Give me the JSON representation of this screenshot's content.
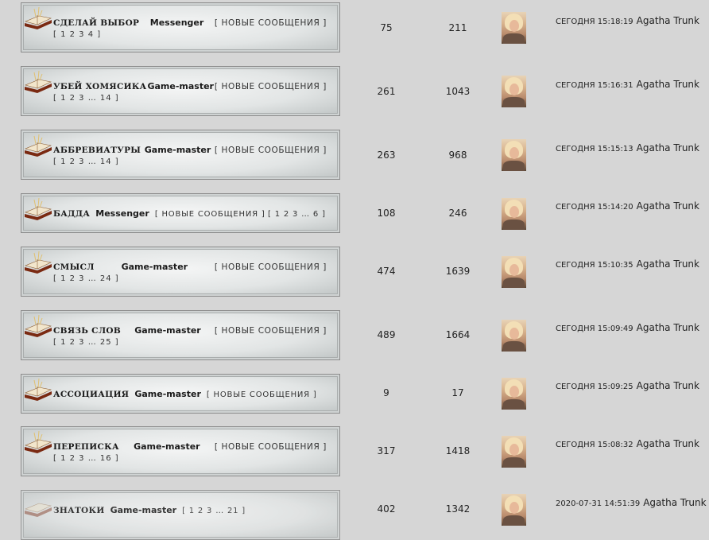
{
  "topics": [
    {
      "name": "СДЕЛАЙ ВЫБОР",
      "author": "Messenger",
      "new": "[ НОВЫЕ СООБЩЕНИЯ ]",
      "pages": "[ 1 2 3 4 ]",
      "topics": "75",
      "posts": "211",
      "last_time": "СЕГОДНЯ 15:18:19",
      "last_user": "Agatha Trunk"
    },
    {
      "name": "УБЕЙ ХОМЯСИКА",
      "author": "Game-master",
      "new": "[ НОВЫЕ СООБЩЕНИЯ ]",
      "pages": "[ 1 2 3 … 14 ]",
      "topics": "261",
      "posts": "1043",
      "last_time": "СЕГОДНЯ 15:16:31",
      "last_user": "Agatha Trunk"
    },
    {
      "name": "АББРЕВИАТУРЫ",
      "author": "Game-master",
      "new": "[ НОВЫЕ СООБЩЕНИЯ ]",
      "pages": "[ 1 2 3 … 14 ]",
      "topics": "263",
      "posts": "968",
      "last_time": "СЕГОДНЯ 15:15:13",
      "last_user": "Agatha Trunk"
    },
    {
      "name": "БАДДА",
      "author": "Messenger",
      "new": "[ НОВЫЕ СООБЩЕНИЯ ]",
      "pages": "[ 1 2 3 … 6 ]",
      "topics": "108",
      "posts": "246",
      "last_time": "СЕГОДНЯ 15:14:20",
      "last_user": "Agatha Trunk"
    },
    {
      "name": "СМЫСЛ",
      "author": "Game-master",
      "new": "[ НОВЫЕ СООБЩЕНИЯ ]",
      "pages": "[ 1 2 3 … 24 ]",
      "topics": "474",
      "posts": "1639",
      "last_time": "СЕГОДНЯ 15:10:35",
      "last_user": "Agatha Trunk"
    },
    {
      "name": "СВЯЗЬ СЛОВ",
      "author": "Game-master",
      "new": "[ НОВЫЕ СООБЩЕНИЯ ]",
      "pages": "[ 1 2 3 … 25 ]",
      "topics": "489",
      "posts": "1664",
      "last_time": "СЕГОДНЯ 15:09:49",
      "last_user": "Agatha Trunk"
    },
    {
      "name": "АССОЦИАЦИЯ",
      "author": "Game-master",
      "new": "[ НОВЫЕ СООБЩЕНИЯ ]",
      "pages": "",
      "topics": "9",
      "posts": "17",
      "last_time": "СЕГОДНЯ 15:09:25",
      "last_user": "Agatha Trunk"
    },
    {
      "name": "ПЕРЕПИСКА",
      "author": "Game-master",
      "new": "[ НОВЫЕ СООБЩЕНИЯ ]",
      "pages": "[ 1 2 3 … 16 ]",
      "topics": "317",
      "posts": "1418",
      "last_time": "СЕГОДНЯ 15:08:32",
      "last_user": "Agatha Trunk"
    },
    {
      "name": "ЗНАТОКИ",
      "author": "Game-master",
      "new": "[ 1 2 3 … 21 ]",
      "pages": "",
      "topics": "402",
      "posts": "1342",
      "last_time": "2020-07-31 14:51:39",
      "last_user": "Agatha Trunk"
    }
  ]
}
